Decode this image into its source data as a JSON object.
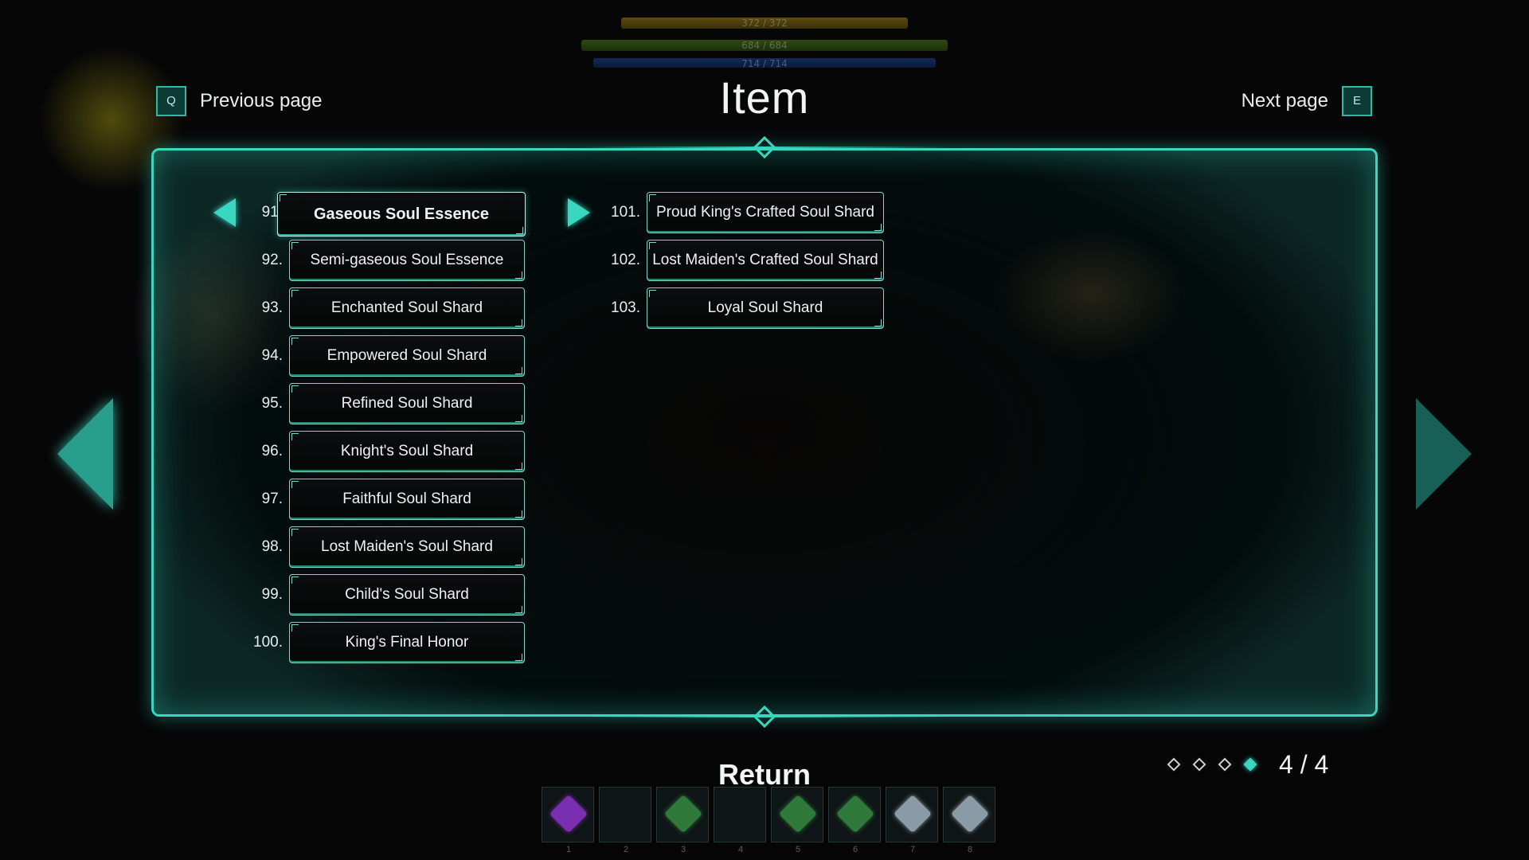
{
  "status": {
    "stamina": "372 / 372",
    "hp": "684 / 684",
    "mp": "714 / 714"
  },
  "header": {
    "title": "Item",
    "prev_key": "Q",
    "prev_label": "Previous page",
    "next_label": "Next page",
    "next_key": "E"
  },
  "items_left": [
    {
      "num": "91.",
      "name": "Gaseous Soul Essence"
    },
    {
      "num": "92.",
      "name": "Semi-gaseous Soul Essence"
    },
    {
      "num": "93.",
      "name": "Enchanted Soul Shard"
    },
    {
      "num": "94.",
      "name": "Empowered Soul Shard"
    },
    {
      "num": "95.",
      "name": "Refined Soul Shard"
    },
    {
      "num": "96.",
      "name": "Knight's Soul Shard"
    },
    {
      "num": "97.",
      "name": "Faithful Soul Shard"
    },
    {
      "num": "98.",
      "name": "Lost Maiden's Soul Shard"
    },
    {
      "num": "99.",
      "name": "Child's Soul Shard"
    },
    {
      "num": "100.",
      "name": "King's Final Honor"
    }
  ],
  "items_right": [
    {
      "num": "101.",
      "name": "Proud King's Crafted Soul Shard"
    },
    {
      "num": "102.",
      "name": "Lost Maiden's Crafted Soul Shard"
    },
    {
      "num": "103.",
      "name": "Loyal Soul Shard"
    }
  ],
  "selected_item": "Gaseous Soul Essence",
  "pager": {
    "current": 4,
    "total": 4,
    "label": "4 / 4"
  },
  "footer": {
    "return_label": "Return"
  },
  "hotbar": {
    "slots": [
      {
        "num": "1",
        "gem": "purple"
      },
      {
        "num": "2",
        "gem": ""
      },
      {
        "num": "3",
        "gem": "green"
      },
      {
        "num": "4",
        "gem": ""
      },
      {
        "num": "5",
        "gem": "green"
      },
      {
        "num": "6",
        "gem": "green"
      },
      {
        "num": "7",
        "gem": "silver"
      },
      {
        "num": "8",
        "gem": "silver"
      }
    ]
  },
  "colors": {
    "accent": "#39d6c0",
    "purple": "#7a2fb0",
    "green": "#2f7a3a",
    "silver": "#8a9aa6"
  },
  "icons": {
    "selection_cursor": "double-chevron-icon",
    "side_nav": "ornate-arrow-icon",
    "page_indicator": "diamond-icon"
  }
}
